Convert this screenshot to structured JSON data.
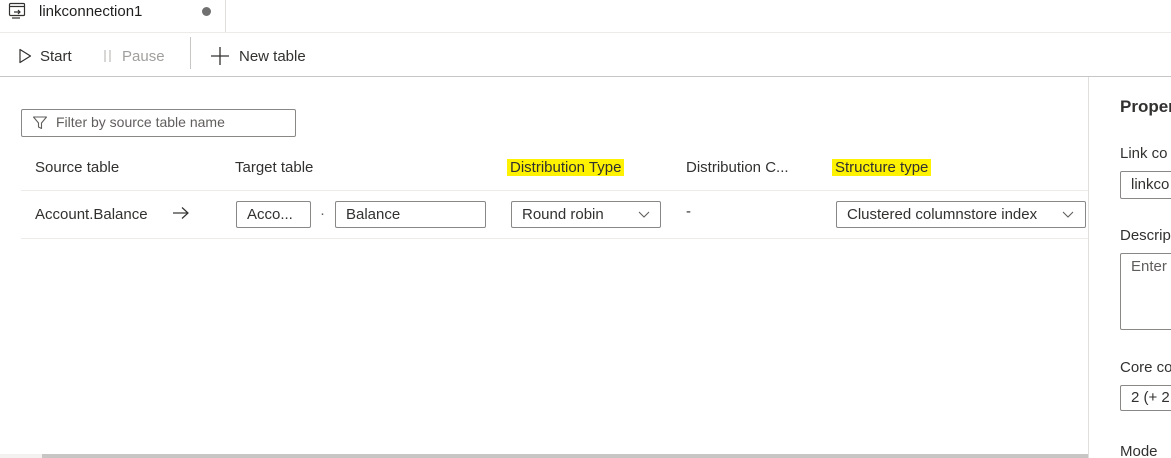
{
  "tab": {
    "label": "linkconnection1"
  },
  "toolbar": {
    "start": "Start",
    "pause": "Pause",
    "new_table": "New table"
  },
  "filter": {
    "placeholder": "Filter by source table name"
  },
  "table": {
    "headers": {
      "source": "Source table",
      "target": "Target table",
      "distribution_type": "Distribution Type",
      "distribution_column": "Distribution C...",
      "structure_type": "Structure type"
    },
    "rows": [
      {
        "source": "Account.Balance",
        "target_schema": "Acco...",
        "separator": "·",
        "target_table": "Balance",
        "distribution_type": "Round robin",
        "distribution_column": "-",
        "structure_type": "Clustered columnstore index"
      }
    ]
  },
  "properties": {
    "title": "Proper",
    "link_label": "Link co",
    "link_value": "linkco",
    "description_label": "Descrip",
    "description_placeholder": "Enter",
    "core_label": "Core co",
    "core_value": "2 (+ 2",
    "mode_label": "Mode"
  },
  "colors": {
    "highlight": "#fff200",
    "border": "#8a8886",
    "text": "#323130"
  },
  "icons": [
    "pipeline-tab-icon",
    "play-icon",
    "pause-icon",
    "plus-icon",
    "filter-icon",
    "arrow-right-icon",
    "chevron-down-icon"
  ]
}
